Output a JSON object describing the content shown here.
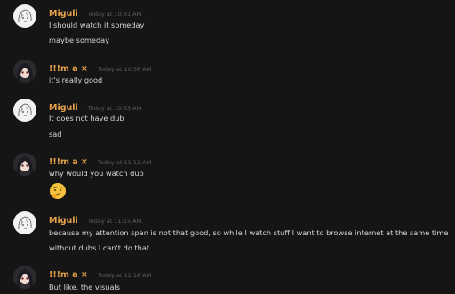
{
  "colors": {
    "background": "#151515",
    "text": "#d6d6d6",
    "timestamp": "#5c5f63",
    "username": "#e8a34a"
  },
  "messages": [
    {
      "author": "Miguli",
      "avatar": "sketch-avatar",
      "timestamp": "Today at 10:31 AM",
      "lines": [
        "I should watch it someday",
        "maybe someday"
      ]
    },
    {
      "author": "!!!m a ×",
      "avatar": "anime-girl-avatar",
      "timestamp": "Today at 10:36 AM",
      "lines": [
        "it's really good"
      ]
    },
    {
      "author": "Miguli",
      "avatar": "sketch-avatar",
      "timestamp": "Today at 10:53 AM",
      "lines": [
        "It does not have dub",
        "sad"
      ]
    },
    {
      "author": "!!!m a ×",
      "avatar": "anime-girl-avatar",
      "timestamp": "Today at 11:12 AM",
      "lines": [
        "why would you watch dub"
      ],
      "emoji": "thinking-face"
    },
    {
      "author": "Miguli",
      "avatar": "sketch-avatar",
      "timestamp": "Today at 11:15 AM",
      "lines": [
        "because my attention span is not that good, so while I watch stuff I want to browse internet at the same time",
        "without dubs I can't do that"
      ]
    },
    {
      "author": "!!!m a ×",
      "avatar": "anime-girl-avatar",
      "timestamp": "Today at 11:18 AM",
      "lines": [
        "But like, the visuals"
      ]
    }
  ]
}
